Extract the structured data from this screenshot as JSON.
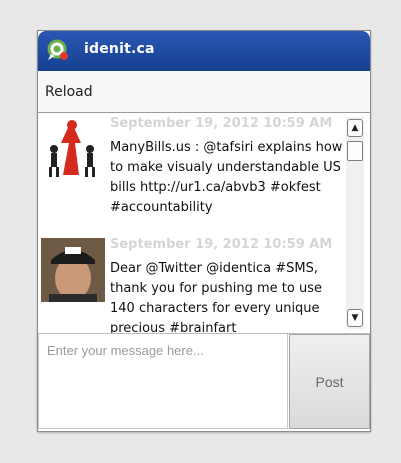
{
  "window": {
    "title": "idenit.ca",
    "app_icon": "identica-logo-icon"
  },
  "toolbar": {
    "reload_label": "Reload"
  },
  "timeline": {
    "statuses": [
      {
        "timestamp": "September 19, 2012 10:59 AM",
        "avatar": "manybills-logo-avatar",
        "text": "ManyBills.us : @tafsiri explains how to make visualy understandable US bills http://ur1.ca/abvb3 #okfest #accountability"
      },
      {
        "timestamp": "September 19, 2012 10:59 AM",
        "avatar": "user-photo-avatar",
        "text": "Dear @Twitter @identica #SMS, thank you for pushing me to use 140 characters for every unique precious #brainfart"
      }
    ]
  },
  "scrollbar": {
    "up_icon": "scroll-up-arrow-icon",
    "down_icon": "scroll-down-arrow-icon"
  },
  "composer": {
    "placeholder": "Enter your message here...",
    "post_label": "Post"
  },
  "colors": {
    "titlebar": "#1f4fa8",
    "timestamp": "#d5d5d5"
  }
}
